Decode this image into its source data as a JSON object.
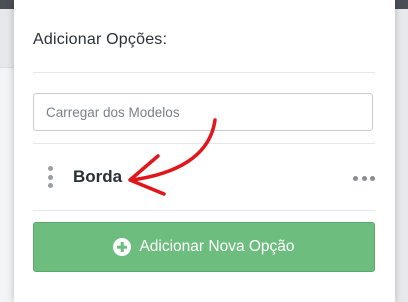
{
  "panel": {
    "title": "Adicionar Opções:",
    "search_placeholder": "Carregar dos Modelos",
    "options": [
      {
        "label": "Borda"
      }
    ],
    "add_button_label": "Adicionar Nova Opção"
  },
  "colors": {
    "accent_green": "#6cbd7e",
    "annotation_arrow": "#e0161a",
    "topbar": "#4a4f55"
  },
  "icons": {
    "drag_handle": "drag-handle-icon",
    "more": "more-horizontal-icon",
    "add": "plus-circle-icon"
  }
}
